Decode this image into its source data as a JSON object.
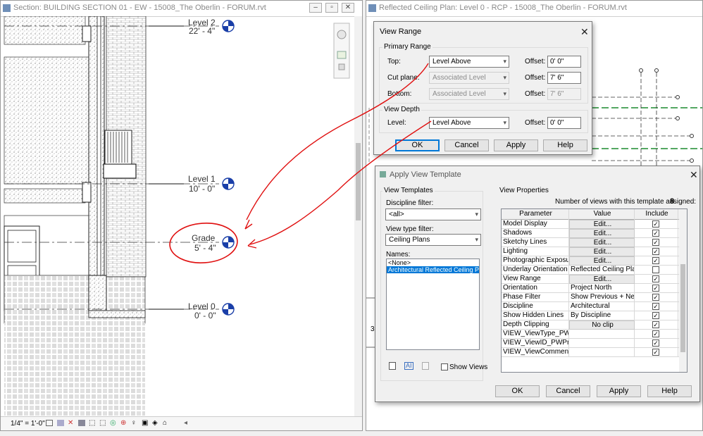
{
  "section_window": {
    "title": "Section: BUILDING SECTION 01 - EW - 15008_The Oberlin - FORUM.rvt",
    "scale": "1/4\" = 1'-0\"",
    "levels": [
      {
        "name": "Level 2",
        "elev": "22' - 4\""
      },
      {
        "name": "Level 1",
        "elev": "10' - 0\""
      },
      {
        "name": "Grade",
        "elev": "5' - 4\""
      },
      {
        "name": "Level 0",
        "elev": "0' - 0\""
      }
    ]
  },
  "rcp_window": {
    "title": "Reflected Ceiling Plan: Level 0 - RCP - 15008_The Oberlin - FORUM.rvt",
    "edge_label": "3"
  },
  "view_range": {
    "title": "View Range",
    "primary_range": "Primary Range",
    "top_label": "Top:",
    "top_value": "Level Above",
    "top_offset_label": "Offset:",
    "top_offset": "0'  0\"",
    "cut_label": "Cut plane:",
    "cut_value": "Associated Level",
    "cut_offset_label": "Offset:",
    "cut_offset": "7'  6\"",
    "bottom_label": "Bottom:",
    "bottom_value": "Associated Level",
    "bottom_offset_label": "Offset:",
    "bottom_offset": "7'  6\"",
    "view_depth": "View Depth",
    "level_label": "Level:",
    "level_value": "Level Above",
    "level_offset_label": "Offset:",
    "level_offset": "0'  0\"",
    "buttons": {
      "ok": "OK",
      "cancel": "Cancel",
      "apply": "Apply",
      "help": "Help"
    }
  },
  "apply_template": {
    "title": "Apply View Template",
    "view_templates": "View Templates",
    "discipline_filter_label": "Discipline filter:",
    "discipline_filter_value": "<all>",
    "view_type_filter_label": "View type filter:",
    "view_type_filter_value": "Ceiling Plans",
    "names_label": "Names:",
    "names": [
      "<None>",
      "Architectural Reflected Ceiling Plan"
    ],
    "selected_name": "Architectural Reflected Ceiling Plan",
    "show_views_label": "Show Views",
    "view_properties": "View Properties",
    "assigned_label": "Number of views with this template assigned:",
    "assigned_count": "8",
    "columns": {
      "parameter": "Parameter",
      "value": "Value",
      "include": "Include"
    },
    "rows": [
      {
        "param": "Model Display",
        "value": "Edit...",
        "button": true,
        "include": true
      },
      {
        "param": "Shadows",
        "value": "Edit...",
        "button": true,
        "include": true
      },
      {
        "param": "Sketchy Lines",
        "value": "Edit...",
        "button": true,
        "include": true
      },
      {
        "param": "Lighting",
        "value": "Edit...",
        "button": true,
        "include": true
      },
      {
        "param": "Photographic Exposure",
        "value": "Edit...",
        "button": true,
        "include": true
      },
      {
        "param": "Underlay Orientation",
        "value": "Reflected Ceiling Pla",
        "button": false,
        "include": false
      },
      {
        "param": "View Range",
        "value": "Edit...",
        "button": true,
        "include": true
      },
      {
        "param": "Orientation",
        "value": "Project North",
        "button": false,
        "include": true
      },
      {
        "param": "Phase Filter",
        "value": "Show Previous + Ne",
        "button": false,
        "include": true
      },
      {
        "param": "Discipline",
        "value": "Architectural",
        "button": false,
        "include": true
      },
      {
        "param": "Show Hidden Lines",
        "value": "By Discipline",
        "button": false,
        "include": true
      },
      {
        "param": "Depth Clipping",
        "value": "No clip",
        "button": true,
        "include": true
      },
      {
        "param": "VIEW_ViewType_PWProj",
        "value": "",
        "button": false,
        "include": true
      },
      {
        "param": "VIEW_ViewID_PWProj",
        "value": "",
        "button": false,
        "include": true
      },
      {
        "param": "VIEW_ViewComments_",
        "value": "",
        "button": false,
        "include": true
      }
    ],
    "buttons": {
      "ok": "OK",
      "cancel": "Cancel",
      "apply": "Apply",
      "help": "Help"
    }
  },
  "colors": {
    "annotation": "#e01010",
    "accent": "#0078d7",
    "level_marker": "#1a3fa8",
    "grid_green": "#1c8a2e"
  }
}
